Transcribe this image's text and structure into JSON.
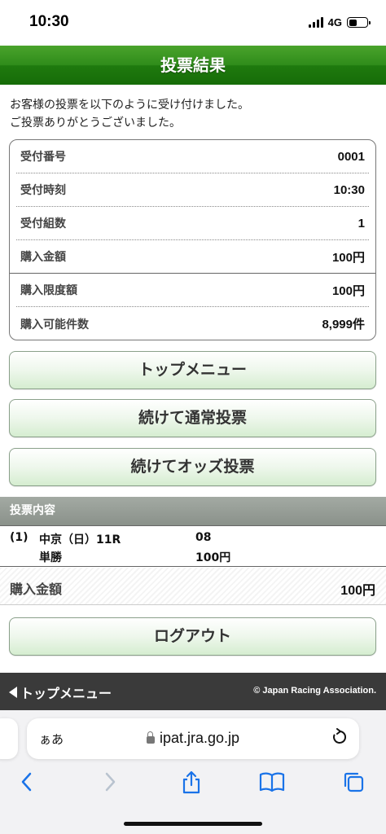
{
  "status_bar": {
    "time": "10:30",
    "network": "4G"
  },
  "header": {
    "title": "投票結果"
  },
  "intro": {
    "line1": "お客様の投票を以下のように受け付けました。",
    "line2": "ご投票ありがとうございました。"
  },
  "info": {
    "rows": [
      {
        "label": "受付番号",
        "value": "0001"
      },
      {
        "label": "受付時刻",
        "value": "10:30"
      },
      {
        "label": "受付組数",
        "value": "1"
      },
      {
        "label": "購入金額",
        "value": "100円"
      },
      {
        "label": "購入限度額",
        "value": "100円"
      },
      {
        "label": "購入可能件数",
        "value": "8,999件"
      }
    ]
  },
  "buttons": {
    "top_menu": "トップメニュー",
    "continue_normal": "続けて通常投票",
    "continue_odds": "続けてオッズ投票",
    "logout": "ログアウト"
  },
  "bet_section": {
    "title": "投票内容",
    "bet": {
      "index": "(1)",
      "race": "中京（日）11R",
      "number": "08",
      "type": "単勝",
      "amount": "100円"
    },
    "total_label": "購入金額",
    "total_value": "100円"
  },
  "footer": {
    "link": "トップメニュー",
    "copyright": "© Japan Racing Association."
  },
  "browser": {
    "aa": "ぁあ",
    "url": "ipat.jra.go.jp"
  }
}
